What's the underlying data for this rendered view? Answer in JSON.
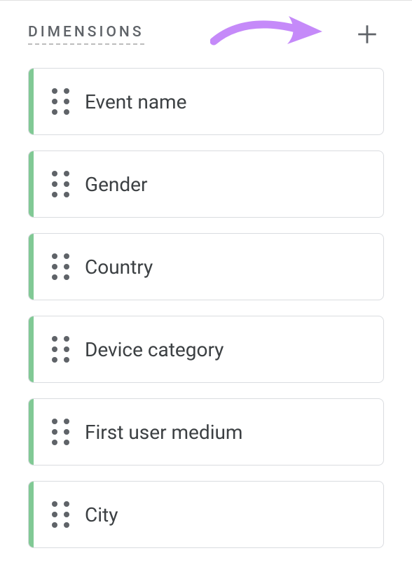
{
  "section": {
    "title": "DIMENSIONS"
  },
  "dimensions": {
    "items": [
      {
        "label": "Event name"
      },
      {
        "label": "Gender"
      },
      {
        "label": "Country"
      },
      {
        "label": "Device category"
      },
      {
        "label": "First user medium"
      },
      {
        "label": "City"
      }
    ]
  }
}
